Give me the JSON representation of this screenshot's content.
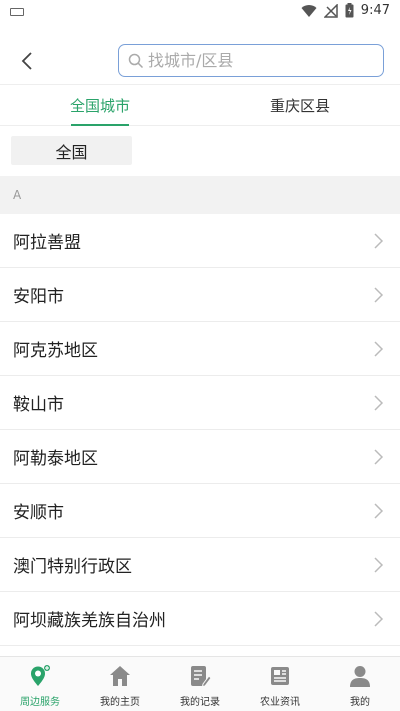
{
  "status_bar": {
    "time": "9:47"
  },
  "search": {
    "placeholder": "找城市/区县"
  },
  "tabs": [
    {
      "label": "全国城市",
      "active": true
    },
    {
      "label": "重庆区县",
      "active": false
    }
  ],
  "chip": {
    "label": "全国"
  },
  "section": {
    "letter": "A"
  },
  "cities": [
    {
      "name": "阿拉善盟"
    },
    {
      "name": "安阳市"
    },
    {
      "name": "阿克苏地区"
    },
    {
      "name": "鞍山市"
    },
    {
      "name": "阿勒泰地区"
    },
    {
      "name": "安顺市"
    },
    {
      "name": "澳门特别行政区"
    },
    {
      "name": "阿坝藏族羌族自治州"
    }
  ],
  "bottom_nav": [
    {
      "label": "周边服务",
      "icon": "location-pin-icon",
      "active": true
    },
    {
      "label": "我的主页",
      "icon": "home-icon",
      "active": false
    },
    {
      "label": "我的记录",
      "icon": "record-edit-icon",
      "active": false
    },
    {
      "label": "农业资讯",
      "icon": "news-icon",
      "active": false
    },
    {
      "label": "我的",
      "icon": "user-icon",
      "active": false
    }
  ],
  "colors": {
    "accent": "#2aa36a",
    "search_border": "#7aa0d8",
    "inactive_icon": "#8a8a8a"
  }
}
